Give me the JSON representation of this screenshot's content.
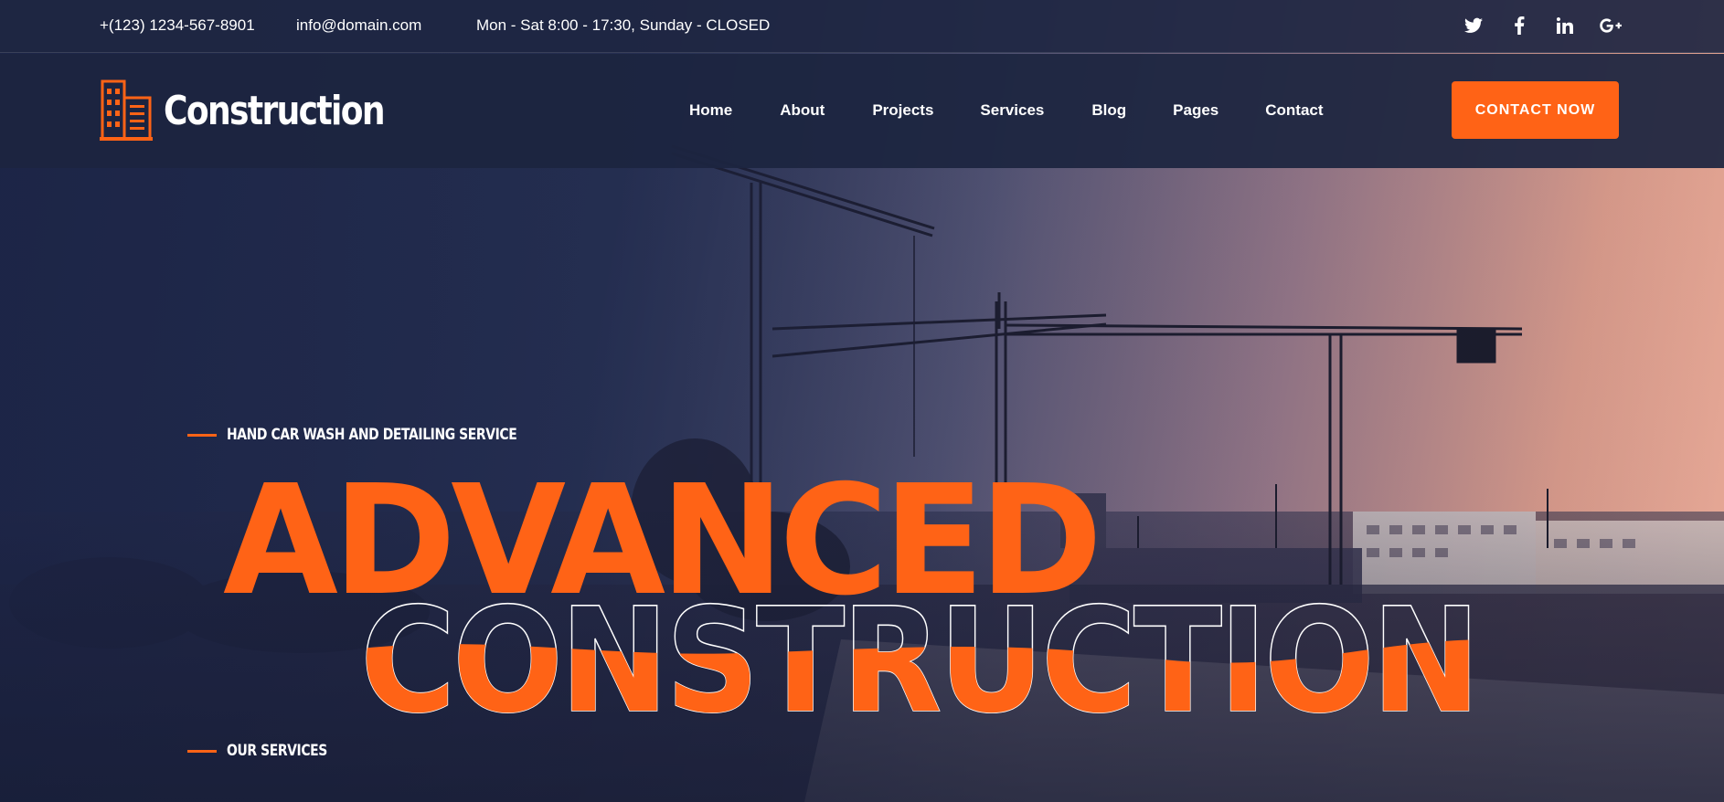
{
  "colors": {
    "accent": "#ff6316",
    "header_bg": "#1c2540",
    "text": "#ffffff"
  },
  "topbar": {
    "phone": "+(123) 1234-567-8901",
    "email": "info@domain.com",
    "hours": "Mon - Sat 8:00 - 17:30, Sunday - CLOSED",
    "social": [
      {
        "name": "twitter-icon",
        "glyph": "𝕥"
      },
      {
        "name": "facebook-icon",
        "glyph": "f"
      },
      {
        "name": "linkedin-icon",
        "glyph": "in"
      },
      {
        "name": "google-plus-icon",
        "glyph": "G+"
      }
    ]
  },
  "header": {
    "logo_text": "Construction",
    "nav": [
      "Home",
      "About",
      "Projects",
      "Services",
      "Blog",
      "Pages",
      "Contact"
    ],
    "cta_label": "CONTACT NOW"
  },
  "hero": {
    "kicker": "HAND CAR WASH AND DETAILING SERVICE",
    "headline_line1": "ADVANCED",
    "headline_line2": "CONSTRUCTION",
    "services_label": "OUR SERVICES"
  }
}
